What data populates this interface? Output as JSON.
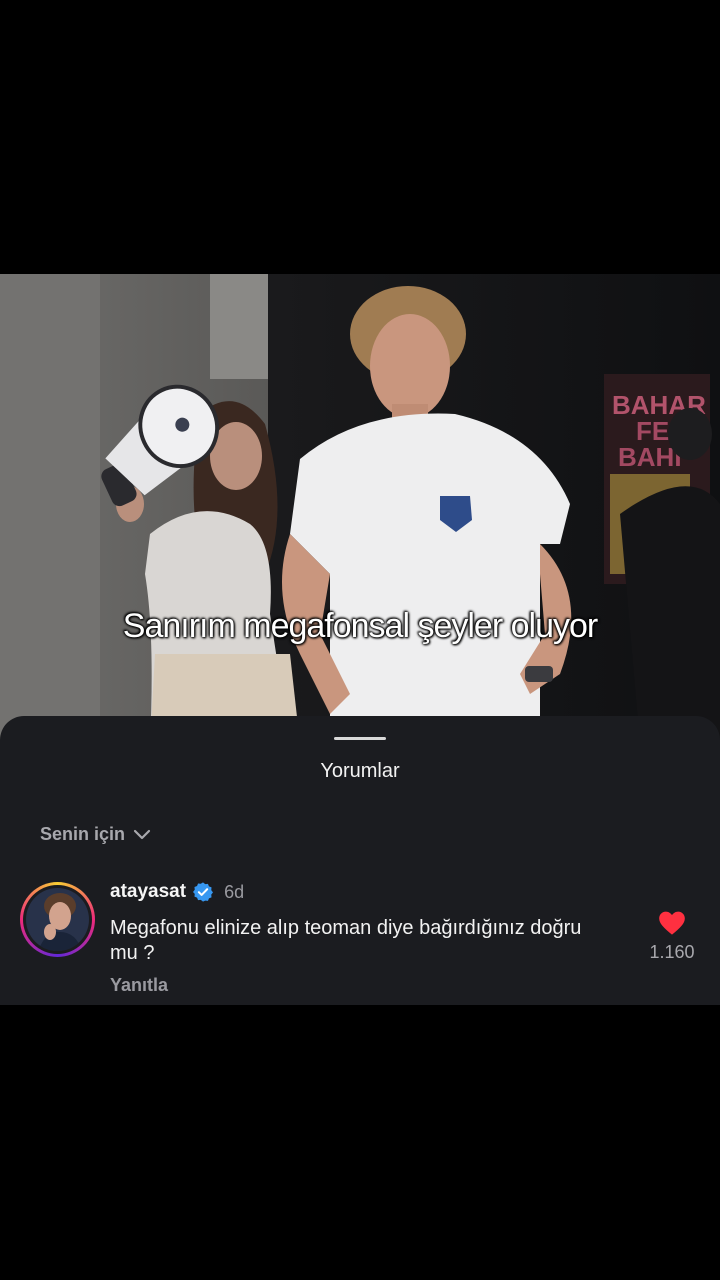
{
  "video": {
    "caption": "Sanırım megafonsal şeyler oluyor",
    "poster_text": "BAHAR FEST BAHAR"
  },
  "comments_sheet": {
    "title": "Yorumlar",
    "filter_label": "Senin için",
    "comment": {
      "username": "atayasat",
      "verified": true,
      "time": "6d",
      "text": "Megafonu elinize alıp teoman diye bağırdığınız doğru mu ?",
      "reply_label": "Yanıtla",
      "like_count": "1.160",
      "liked": true
    }
  },
  "colors": {
    "sheet_bg": "#1b1c20",
    "like_red": "#ff3040",
    "verified_blue": "#3797f0"
  },
  "icons": [
    "chevron-down-icon",
    "verified-badge-icon",
    "heart-filled-icon"
  ]
}
